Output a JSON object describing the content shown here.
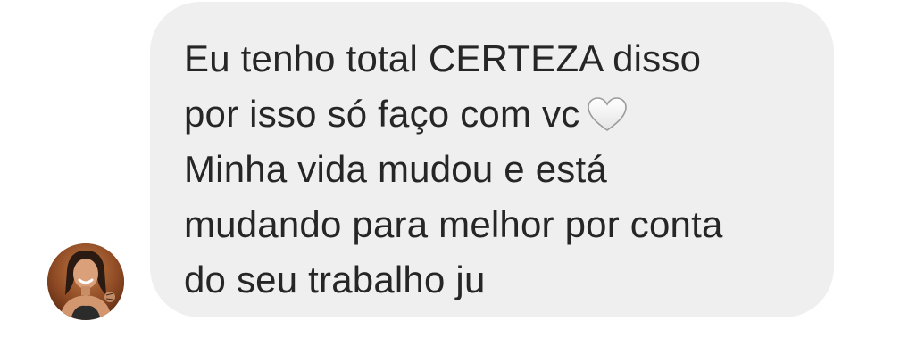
{
  "conversation": {
    "message": {
      "lines": [
        "Eu tenho total CERTEZA disso",
        "por isso só faço com vc",
        "Minha vida mudou e está",
        "mudando para melhor por conta",
        "do seu trabalho ju"
      ],
      "emoji": "white-heart-icon"
    },
    "sender": {
      "avatar_icon": "avatar"
    }
  },
  "colors": {
    "bubble_background": "#efefef",
    "text": "#262626",
    "page_background": "#ffffff"
  }
}
